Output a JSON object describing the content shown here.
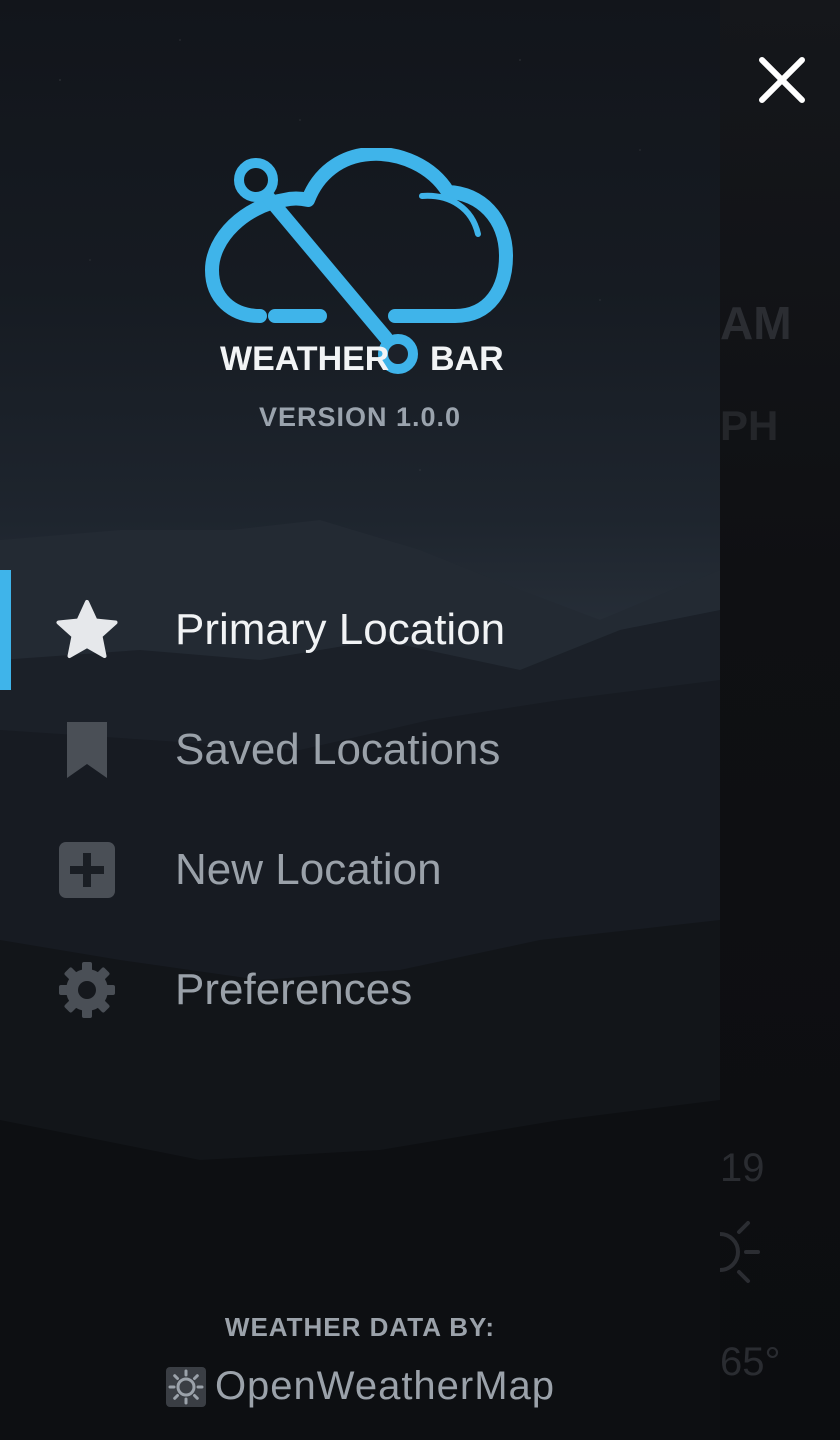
{
  "app": {
    "logo_left_text": "WEATHER",
    "logo_right_text": "BAR",
    "version": "VERSION 1.0.0",
    "accent_color": "#3fb4ea"
  },
  "menu": {
    "items": [
      {
        "label": "Primary Location",
        "icon": "star-icon",
        "active": true
      },
      {
        "label": "Saved Locations",
        "icon": "bookmark-icon",
        "active": false
      },
      {
        "label": "New Location",
        "icon": "plus-square-icon",
        "active": false
      },
      {
        "label": "Preferences",
        "icon": "gear-icon",
        "active": false
      }
    ]
  },
  "footer": {
    "caption": "WEATHER DATA BY:",
    "provider": "OpenWeatherMap",
    "provider_icon": "openweathermap-logo-icon"
  },
  "background_app": {
    "peek_texts": [
      "AM",
      "PH",
      "19",
      "65°"
    ]
  },
  "controls": {
    "close_icon": "close-icon"
  }
}
